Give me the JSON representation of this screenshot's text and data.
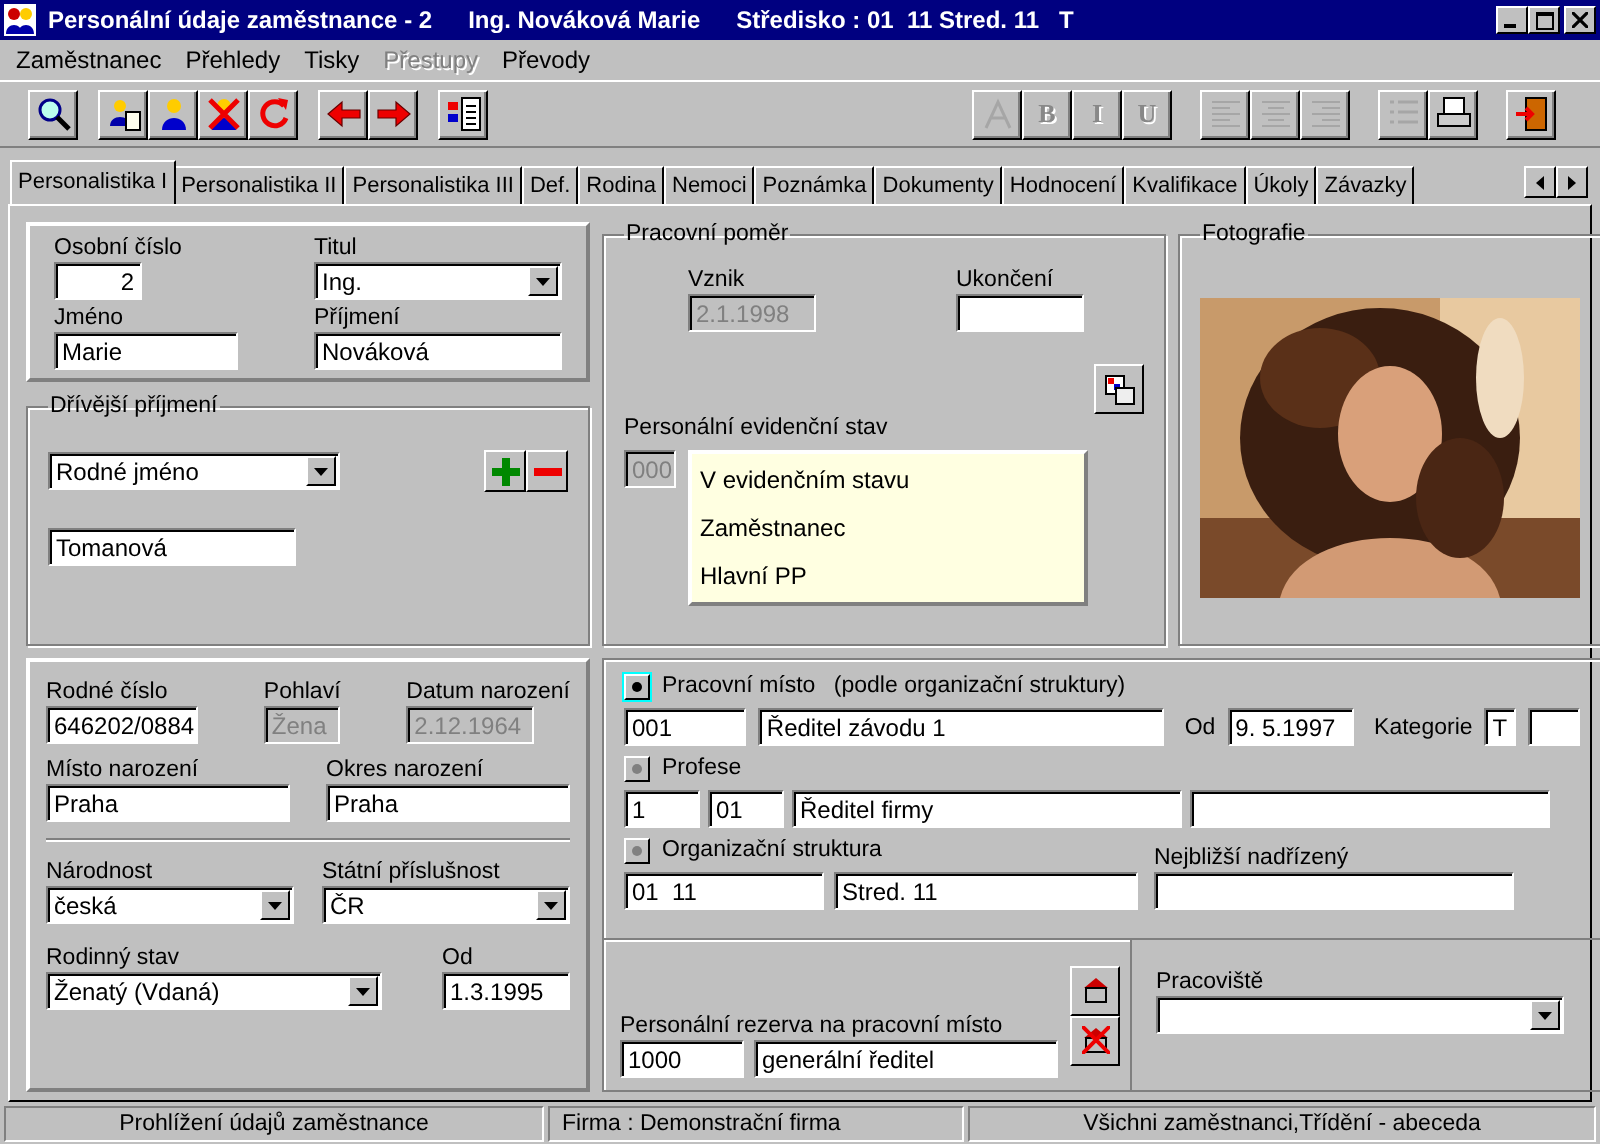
{
  "window": {
    "title": "Personální údaje zaměstnance - 2",
    "employee": "Ing. Nováková Marie",
    "center": "Středisko : 01  11 Stred. 11   T"
  },
  "menu": [
    {
      "label": "Zaměstnanec",
      "disabled": false
    },
    {
      "label": "Přehledy",
      "disabled": false
    },
    {
      "label": "Tisky",
      "disabled": false
    },
    {
      "label": "Přestupy",
      "disabled": true
    },
    {
      "label": "Převody",
      "disabled": false
    }
  ],
  "toolbar": {
    "left": [
      [
        {
          "kind": "search",
          "disabled": false
        }
      ],
      [
        {
          "kind": "person-edit",
          "disabled": false
        },
        {
          "kind": "person",
          "disabled": false
        },
        {
          "kind": "person-delete",
          "disabled": false
        },
        {
          "kind": "refresh",
          "disabled": false
        }
      ],
      [
        {
          "kind": "arrow-left",
          "disabled": false
        },
        {
          "kind": "arrow-right",
          "disabled": false
        }
      ],
      [
        {
          "kind": "document",
          "disabled": false
        }
      ]
    ],
    "right": [
      [
        {
          "kind": "font",
          "disabled": true
        },
        {
          "kind": "letter",
          "label": "B",
          "disabled": true
        },
        {
          "kind": "letter",
          "label": "I",
          "disabled": true
        },
        {
          "kind": "letter",
          "label": "U",
          "disabled": true
        }
      ],
      [
        {
          "kind": "align-left",
          "disabled": true
        },
        {
          "kind": "align-center",
          "disabled": true
        },
        {
          "kind": "align-right",
          "disabled": true
        }
      ],
      [
        {
          "kind": "list",
          "disabled": true
        },
        {
          "kind": "print",
          "disabled": false
        }
      ],
      [
        {
          "kind": "exit",
          "disabled": false
        }
      ]
    ]
  },
  "tabs": [
    {
      "label": "Personalistika I",
      "selected": true
    },
    {
      "label": "Personalistika II",
      "selected": false
    },
    {
      "label": "Personalistika III",
      "selected": false
    },
    {
      "label": "Def.",
      "selected": false
    },
    {
      "label": "Rodina",
      "selected": false
    },
    {
      "label": "Nemoci",
      "selected": false
    },
    {
      "label": "Poznámka",
      "selected": false
    },
    {
      "label": "Dokumenty",
      "selected": false
    },
    {
      "label": "Hodnocení",
      "selected": false
    },
    {
      "label": "Kvalifikace",
      "selected": false
    },
    {
      "label": "Úkoly",
      "selected": false
    },
    {
      "label": "Závazky",
      "selected": false
    }
  ],
  "identity": {
    "personal_number": {
      "label": "Osobní číslo",
      "value": "2",
      "kind": "text"
    },
    "title": {
      "label": "Titul",
      "value": "Ing.",
      "kind": "combo"
    },
    "first_name": {
      "label": "Jméno",
      "value": "Marie",
      "kind": "text"
    },
    "surname": {
      "label": "Příjmení",
      "value": "Nováková",
      "kind": "text"
    }
  },
  "former_surname": {
    "title": "Dřívější příjmení",
    "type": {
      "value": "Rodné jméno",
      "kind": "combo"
    },
    "value": {
      "value": "Tomanová",
      "kind": "text"
    }
  },
  "employment": {
    "title": "Pracovní poměr",
    "start": {
      "label": "Vznik",
      "value": "2.1.1998",
      "kind": "text",
      "disabled": true
    },
    "end": {
      "label": "Ukončení",
      "kind": "text"
    },
    "status_label": "Personální evidenční stav",
    "status_code": {
      "value": "000",
      "kind": "text",
      "disabled": true
    },
    "status_lines": [
      "V evidenčním stavu",
      "Zaměstnanec",
      "Hlavní PP"
    ]
  },
  "photo": {
    "title": "Fotografie",
    "kind": "picture"
  },
  "personal": {
    "birth_number": {
      "label": "Rodné číslo",
      "value": "646202/0884",
      "kind": "text"
    },
    "sex": {
      "label": "Pohlaví",
      "value": "Žena",
      "kind": "text",
      "disabled": true
    },
    "birth_date": {
      "label": "Datum narození",
      "value": "2.12.1964",
      "kind": "text",
      "disabled": true
    },
    "birth_place": {
      "label": "Místo narození",
      "value": "Praha",
      "kind": "text"
    },
    "birth_district": {
      "label": "Okres narození",
      "value": "Praha",
      "kind": "text"
    },
    "nationality": {
      "label": "Národnost",
      "value": "česká",
      "kind": "combo"
    },
    "citizenship": {
      "label": "Státní příslušnost",
      "value": "ČR",
      "kind": "combo"
    },
    "marital_status": {
      "label": "Rodinný stav",
      "value": "Ženatý (Vdaná)",
      "kind": "combo"
    },
    "since": {
      "label": "Od",
      "value": "1.3.1995",
      "kind": "text"
    }
  },
  "position": {
    "options": [
      {
        "label": "Pracovní místo",
        "note": "(podle organizační struktury)",
        "selected": true
      },
      {
        "label": "Profese",
        "selected": false
      },
      {
        "label": "Organizační struktura",
        "selected": false
      }
    ],
    "job_code": {
      "value": "001",
      "kind": "text"
    },
    "job_name": {
      "value": "Ředitel závodu 1",
      "kind": "text"
    },
    "since": {
      "label": "Od",
      "value": "9. 5.1997",
      "kind": "text"
    },
    "category": {
      "label": "Kategorie",
      "value": "T",
      "kind": "text"
    },
    "category_2": {
      "kind": "text"
    },
    "profession": [
      {
        "value": "1",
        "kind": "text"
      },
      {
        "value": "01",
        "kind": "text"
      },
      {
        "value": "Ředitel firmy",
        "kind": "text"
      },
      {
        "kind": "text"
      }
    ],
    "org_code": {
      "value": "01  11",
      "kind": "text"
    },
    "org_name": {
      "value": "Stred. 11",
      "kind": "text"
    },
    "supervisor": {
      "label": "Nejbližší nadřízený",
      "kind": "text"
    }
  },
  "reserve": {
    "label": "Personální rezerva na pracovní místo",
    "code": {
      "value": "1000",
      "kind": "text"
    },
    "name": {
      "value": "generální ředitel",
      "kind": "text"
    }
  },
  "workplace": {
    "label": "Pracoviště",
    "kind": "combo"
  },
  "status_bar": [
    "Prohlížení údajů zaměstnance",
    "Firma :  Demonstrační firma",
    "Všichni zaměstnanci,Třídění - abeceda"
  ]
}
